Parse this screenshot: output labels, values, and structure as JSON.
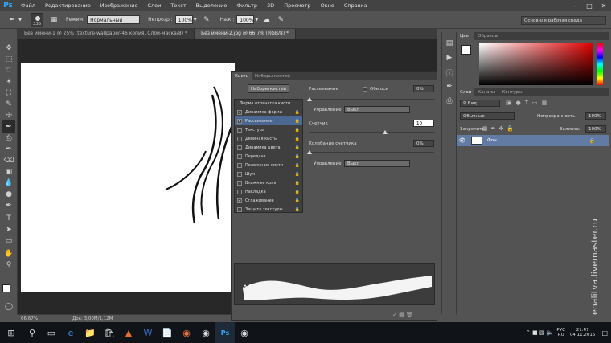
{
  "menubar": {
    "logo": "Ps",
    "items": [
      "Файл",
      "Редактирование",
      "Изображение",
      "Слои",
      "Текст",
      "Выделение",
      "Фильтр",
      "3D",
      "Просмотр",
      "Окно",
      "Справка"
    ]
  },
  "options": {
    "brush_size": "335",
    "mode_label": "Режим:",
    "mode_value": "Нормальный",
    "opacity_label": "Непрозр.:",
    "opacity_value": "100%",
    "press_label": "Наж.:",
    "press_value": "100%",
    "workspace": "Основная рабочая среда"
  },
  "tabs": [
    "Без имени-1 @ 25% (texture-wallpaper-46 копия, Слой-маска/8) *",
    "Без имени-2.jpg @ 66,7% (RGB/8) *"
  ],
  "status": {
    "zoom": "66,67%",
    "doc": "Док: 3,00M/1,12M"
  },
  "brush_panel": {
    "tabs": [
      "Кисть",
      "Наборы кистей"
    ],
    "presets_button": "Наборы кистей",
    "tip_header": "Форма отпечатка кисти",
    "items": [
      {
        "label": "Динамика формы",
        "checked": true
      },
      {
        "label": "Рассеивание",
        "checked": true,
        "selected": true
      },
      {
        "label": "Текстура",
        "checked": false
      },
      {
        "label": "Двойная кисть",
        "checked": false
      },
      {
        "label": "Динамика цвета",
        "checked": false
      },
      {
        "label": "Передача",
        "checked": false
      },
      {
        "label": "Положение кисти",
        "checked": false
      },
      {
        "label": "Шум",
        "checked": false
      },
      {
        "label": "Влажные края",
        "checked": false
      },
      {
        "label": "Накладка",
        "checked": false
      },
      {
        "label": "Сглаживание",
        "checked": true
      },
      {
        "label": "Защита текстуры",
        "checked": false
      }
    ],
    "scatter_label": "Рассеивание",
    "both_axes_label": "Обе оси",
    "scatter_value": "0%",
    "control_label": "Управление:",
    "control_value": "Выкл",
    "count_label": "Счетчик",
    "count_value": "10",
    "count_jitter_label": "Колебание счетчика",
    "count_jitter_value": "0%",
    "control2_label": "Управление:",
    "control2_value": "Выкл"
  },
  "color_panel": {
    "tabs": [
      "Цвет",
      "Образцы"
    ]
  },
  "layers_panel": {
    "tabs": [
      "Слои",
      "Каналы",
      "Контуры"
    ],
    "kind": "Вид",
    "blend": "Обычные",
    "opacity_label": "Непрозрачность:",
    "opacity_value": "100%",
    "lock_label": "Закрепить:",
    "fill_label": "Заливка:",
    "fill_value": "100%",
    "layer_name": "Фон"
  },
  "taskbar": {
    "lang": "РУС",
    "lang2": "RU",
    "time": "21:47",
    "date": "04.11.2015"
  },
  "watermark": "lenalitva.livemaster.ru"
}
